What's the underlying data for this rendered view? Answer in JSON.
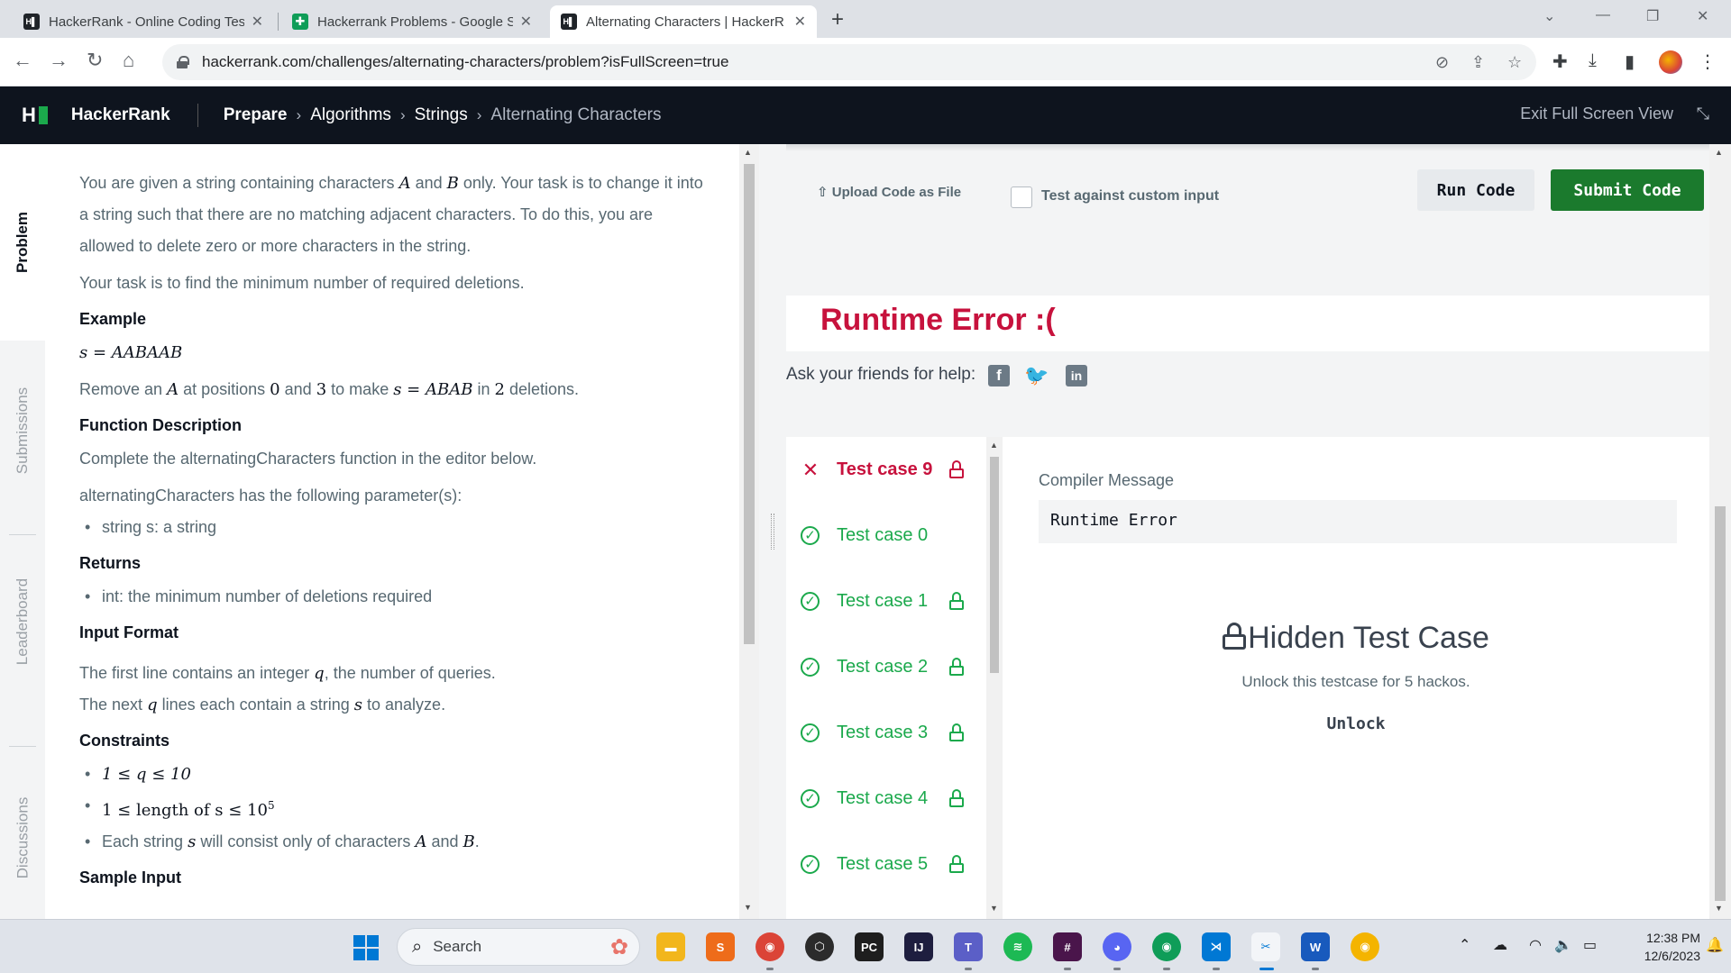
{
  "browser": {
    "tabs": [
      {
        "title": "HackerRank - Online Coding Tes",
        "icon": "hackerrank-favicon",
        "active": false
      },
      {
        "title": "Hackerrank Problems - Google S",
        "icon": "google-sheets-favicon",
        "active": false
      },
      {
        "title": "Alternating Characters | HackerR",
        "icon": "hackerrank-favicon",
        "active": true
      }
    ],
    "new_tab": "+",
    "url": "hackerrank.com/challenges/alternating-characters/problem?isFullScreen=true"
  },
  "header": {
    "logo": "H",
    "brand": "HackerRank",
    "breadcrumbs": [
      {
        "label": "Prepare"
      },
      {
        "label": "Algorithms"
      },
      {
        "label": "Strings"
      },
      {
        "label": "Alternating Characters"
      }
    ],
    "exit_fullscreen": "Exit Full Screen View"
  },
  "side_tabs": {
    "problem": "Problem",
    "submissions": "Submissions",
    "leaderboard": "Leaderboard",
    "discussions": "Discussions"
  },
  "problem": {
    "intro_1": "You are given a string containing characters",
    "intro_a": "A",
    "intro_and": "and",
    "intro_b": "B",
    "intro_2": "only. Your task is to change it into a string such that there are no matching adjacent characters. To do this, you are allowed to delete zero or more characters in the string.",
    "task": "Your task is to find the minimum number of required deletions.",
    "example_heading": "Example",
    "example_s": "s = AABAAB",
    "remove_1": "Remove an",
    "remove_a": "A",
    "remove_2": "at positions",
    "remove_0": "0",
    "remove_and": "and",
    "remove_3": "3",
    "remove_4": "to make",
    "remove_s": "s = ABAB",
    "remove_in": "in",
    "remove_2n": "2",
    "remove_5": "deletions.",
    "function_heading": "Function Description",
    "function_text": "Complete the alternatingCharacters function in the editor below.",
    "params_text": "alternatingCharacters has the following parameter(s):",
    "params": [
      "string s: a string"
    ],
    "returns_heading": "Returns",
    "returns": [
      "int: the minimum number of deletions required"
    ],
    "input_heading": "Input Format",
    "input_1a": "The first line contains an integer",
    "input_1q": "q",
    "input_1b": ", the number of queries.",
    "input_2a": "The next",
    "input_2q": "q",
    "input_2b": "lines each contain a string",
    "input_2s": "s",
    "input_2c": "to analyze.",
    "constraints_heading": "Constraints",
    "constraint_1": "1 ≤ q ≤ 10",
    "constraint_2a": "1 ≤  length of s  ≤ 10",
    "constraint_2exp": "5",
    "constraint_3a": "Each string",
    "constraint_3s": "s",
    "constraint_3b": "will consist only of characters",
    "constraint_3A": "A",
    "constraint_3and": "and",
    "constraint_3B": "B",
    "constraint_3end": ".",
    "sample_heading": "Sample Input"
  },
  "editor_actions": {
    "upload": "Upload Code as File",
    "custom_input": "Test against custom input",
    "run": "Run Code",
    "submit": "Submit Code"
  },
  "result": {
    "status": "Runtime Error :(",
    "share_label": "Ask your friends for help:",
    "share_icons": [
      "facebook-icon",
      "twitter-icon",
      "linkedin-icon"
    ],
    "test_cases": [
      {
        "label": "Test case 9",
        "status": "failed",
        "locked": true
      },
      {
        "label": "Test case 0",
        "status": "passed",
        "locked": false
      },
      {
        "label": "Test case 1",
        "status": "passed",
        "locked": true
      },
      {
        "label": "Test case 2",
        "status": "passed",
        "locked": true
      },
      {
        "label": "Test case 3",
        "status": "passed",
        "locked": true
      },
      {
        "label": "Test case 4",
        "status": "passed",
        "locked": true
      },
      {
        "label": "Test case 5",
        "status": "passed",
        "locked": true
      }
    ],
    "compiler_label": "Compiler Message",
    "compiler_message": "Runtime Error",
    "hidden_title": "Hidden Test Case",
    "hidden_sub": "Unlock this testcase for 5 hackos.",
    "unlock": "Unlock"
  },
  "taskbar": {
    "search": "Search",
    "time": "12:38 PM",
    "date": "12/6/2023"
  },
  "colors": {
    "brand_green": "#1ba94c",
    "submit_green": "#1b7a2d",
    "error_red": "#c7123d",
    "header_dark": "#0e141e"
  }
}
